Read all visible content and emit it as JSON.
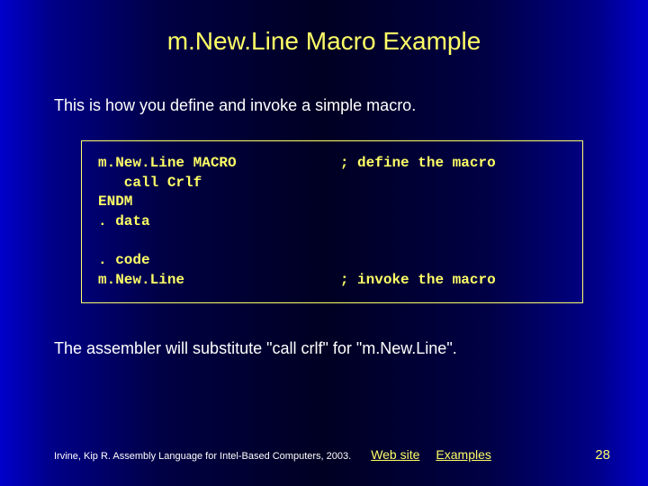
{
  "title": "m.New.Line Macro Example",
  "intro": "This is how you define and invoke a simple macro.",
  "code": {
    "l1a": "m.New.Line MACRO",
    "l1b": "; define the macro",
    "l2": "   call Crlf",
    "l3": "ENDM",
    "l4": ". data",
    "blank": "",
    "l5": ". code",
    "l6a": "m.New.Line",
    "l6b": "; invoke the macro"
  },
  "outro": "The assembler will substitute \"call crlf\" for \"m.New.Line\".",
  "footer": {
    "citation": "Irvine, Kip R. Assembly Language for Intel-Based Computers, 2003.",
    "link1": "Web site",
    "link2": "Examples",
    "page": "28"
  }
}
